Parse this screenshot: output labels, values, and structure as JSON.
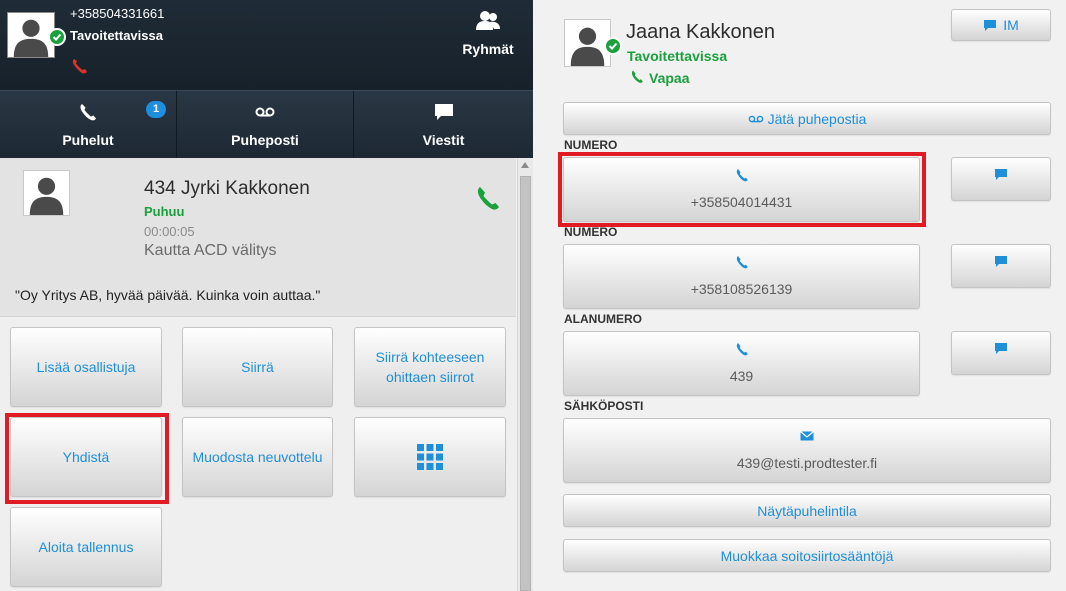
{
  "colors": {
    "accent_blue": "#1f8fd8",
    "status_green": "#1aa03c",
    "highlight_red": "#e01b24",
    "header_dark": "#1f2b36"
  },
  "me": {
    "number": "+358504331661",
    "status": "Tavoitettavissa",
    "phone_icon": "phone-hangup-icon"
  },
  "header": {
    "groups_label": "Ryhmät",
    "groups_icon": "group-icon"
  },
  "tabs": {
    "calls": {
      "label": "Puhelut",
      "badge": "1",
      "icon": "phone-icon"
    },
    "voicemail": {
      "label": "Puheposti",
      "icon": "voicemail-icon"
    },
    "messages": {
      "label": "Viestit",
      "icon": "chat-icon"
    }
  },
  "call": {
    "name": "434 Jyrki Kakkonen",
    "status": "Puhuu",
    "timer": "00:00:05",
    "via": "Kautta ACD välitys",
    "greeting": "\"Oy Yritys AB, hyvää päivää. Kuinka voin auttaa.\""
  },
  "actions": {
    "add_participant": "Lisää osallistuja",
    "transfer": "Siirrä",
    "transfer_bypass": "Siirrä kohteeseen ohittaen siirrot",
    "connect": "Yhdistä",
    "conference": "Muodosta neuvottelu",
    "keypad_icon": "keypad-icon",
    "start_recording": "Aloita tallennus"
  },
  "contact": {
    "name": "Jaana Kakkonen",
    "status": "Tavoitettavissa",
    "call_state": "Vapaa",
    "im_label": "IM",
    "leave_voicemail": "Jätä puhepostia",
    "fields": [
      {
        "label": "NUMERO",
        "value": "+358504014431",
        "icon": "phone-icon"
      },
      {
        "label": "NUMERO",
        "value": "+358108526139",
        "icon": "phone-icon"
      },
      {
        "label": "ALANUMERO",
        "value": "439",
        "icon": "phone-icon"
      },
      {
        "label": "SÄHKÖPOSTI",
        "value": "439@testi.prodtester.fi",
        "icon": "email-icon"
      }
    ],
    "show_phone_state": "Näytäpuhelintila",
    "edit_forwarding": "Muokkaa soitosiirtosääntöjä"
  }
}
